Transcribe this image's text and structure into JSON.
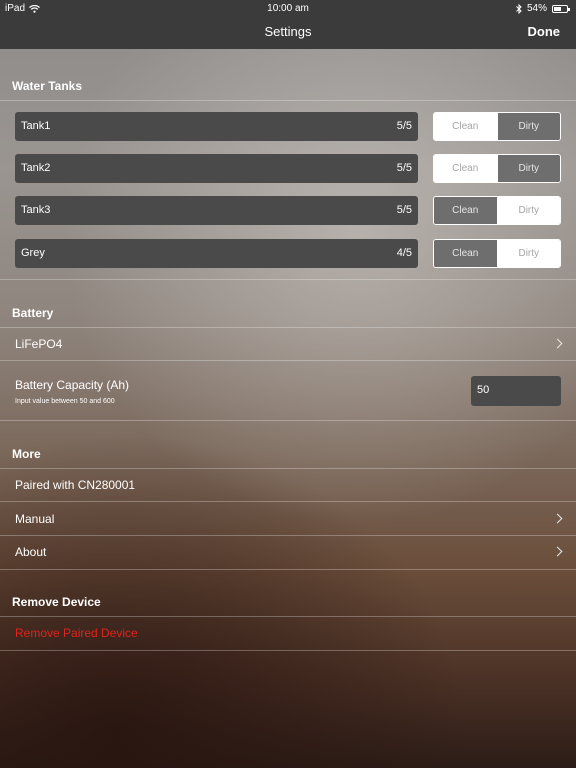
{
  "status_bar": {
    "device": "iPad",
    "time": "10:00 am",
    "battery_percent": "54%",
    "battery_level": 0.54
  },
  "nav": {
    "title": "Settings",
    "done_label": "Done"
  },
  "water_tanks": {
    "header": "Water Tanks",
    "tanks": [
      {
        "name": "Tank1",
        "level": "5/5",
        "clean_label": "Clean",
        "dirty_label": "Dirty",
        "selected": "dirty"
      },
      {
        "name": "Tank2",
        "level": "5/5",
        "clean_label": "Clean",
        "dirty_label": "Dirty",
        "selected": "dirty"
      },
      {
        "name": "Tank3",
        "level": "5/5",
        "clean_label": "Clean",
        "dirty_label": "Dirty",
        "selected": "clean"
      },
      {
        "name": "Grey",
        "level": "4/5",
        "clean_label": "Clean",
        "dirty_label": "Dirty",
        "selected": "clean"
      }
    ]
  },
  "battery": {
    "header": "Battery",
    "type": "LiFePO4",
    "capacity_label": "Battery Capacity (Ah)",
    "capacity_hint": "Input value between 50 and 600",
    "capacity_value": "50"
  },
  "more": {
    "header": "More",
    "paired_text": "Paired with CN280001",
    "manual_label": "Manual",
    "about_label": "About"
  },
  "remove": {
    "header": "Remove Device",
    "action_label": "Remove Paired Device",
    "action_color": "#e0231c"
  }
}
